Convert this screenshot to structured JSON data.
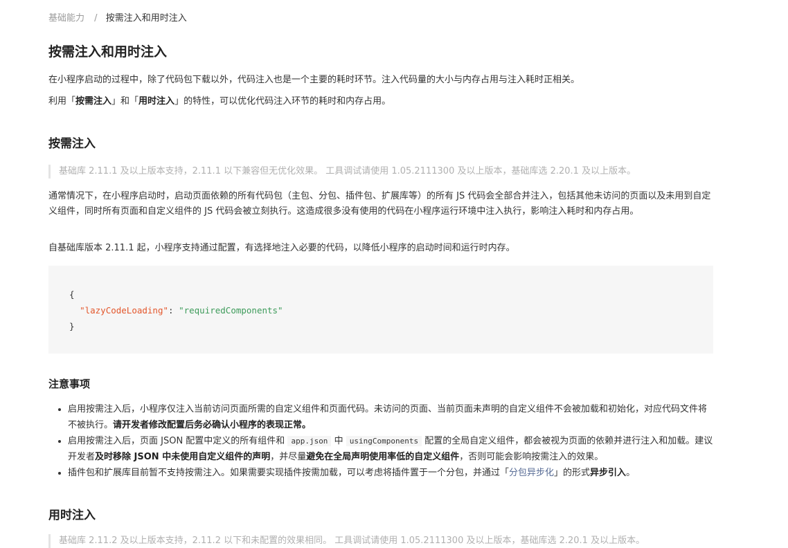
{
  "breadcrumb": {
    "parent": "基础能力",
    "separator": "/",
    "current": "按需注入和用时注入"
  },
  "title": "按需注入和用时注入",
  "intro": {
    "line1": "在小程序启动的过程中，除了代码包下载以外，代码注入也是一个主要的耗时环节。注入代码量的大小与内存占用与注入耗时正相关。",
    "line2_a": "利用「",
    "line2_b": "按需注入",
    "line2_c": "」和「",
    "line2_d": "用时注入",
    "line2_e": "」的特性，可以优化代码注入环节的耗时和内存占用。"
  },
  "section1": {
    "heading": "按需注入",
    "tip": "基础库 2.11.1 及以上版本支持，2.11.1 以下兼容但无优化效果。 工具调试请使用 1.05.2111300 及以上版本，基础库选 2.20.1 及以上版本。",
    "para1": "通常情况下，在小程序启动时，启动页面依赖的所有代码包（主包、分包、插件包、扩展库等）的所有 JS 代码会全部合并注入，包括其他未访问的页面以及未用到自定义组件，同时所有页面和自定义组件的 JS 代码会被立刻执行。这造成很多没有使用的代码在小程序运行环境中注入执行，影响注入耗时和内存占用。",
    "para2": "自基础库版本 2.11.1 起，小程序支持通过配置，有选择地注入必要的代码，以降低小程序的启动时间和运行时内存。",
    "code": {
      "open": "{",
      "key": "\"lazyCodeLoading\"",
      "colon": ": ",
      "value": "\"requiredComponents\"",
      "close": "}"
    }
  },
  "notes": {
    "heading": "注意事项",
    "item1_a": "启用按需注入后，小程序仅注入当前访问页面所需的自定义组件和页面代码。未访问的页面、当前页面未声明的自定义组件不会被加载和初始化，对应代码文件将不被执行。",
    "item1_b": "请开发者修改配置后务必确认小程序的表现正常。",
    "item2_a": "启用按需注入后，页面 JSON 配置中定义的所有组件和",
    "item2_code1": "app.json",
    "item2_b": "中",
    "item2_code2": "usingComponents",
    "item2_c": "配置的全局自定义组件，都会被视为页面的依赖并进行注入和加载。建议开发者",
    "item2_d": "及时移除 JSON 中未使用自定义组件的声明",
    "item2_e": "，并尽量",
    "item2_f": "避免在全局声明使用率低的自定义组件",
    "item2_g": "，否则可能会影响按需注入的效果。",
    "item3_a": "插件包和扩展库目前暂不支持按需注入。如果需要实现插件按需加载，可以考虑将插件置于一个分包，并通过「",
    "item3_link": "分包异步化",
    "item3_b": "」的形式",
    "item3_c": "异步引入",
    "item3_d": "。"
  },
  "section2": {
    "heading": "用时注入",
    "tip": "基础库 2.11.2 及以上版本支持，2.11.2 以下和未配置的效果相同。 工具调试请使用 1.05.2111300 及以上版本，基础库选 2.20.1 及以上版本。"
  },
  "colors": {
    "link": "#576b95",
    "code_key": "#e3562b",
    "code_string": "#3d9b5a",
    "code_bg": "#f6f6f6",
    "tip_text": "#b0b0b0"
  }
}
